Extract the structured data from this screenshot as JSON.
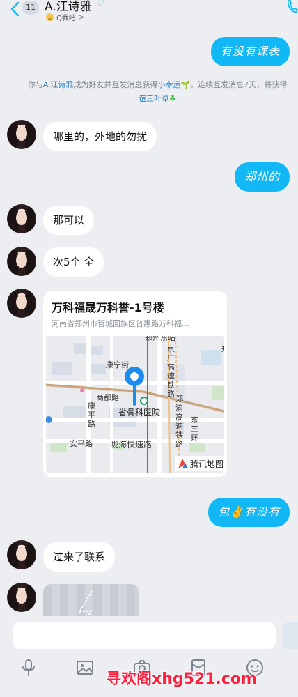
{
  "header": {
    "unread_count": "11",
    "contact_name": "A.江诗雅",
    "contact_name_mark": "♡",
    "qzone_label": "Q我吧",
    "qzone_arrow": ">"
  },
  "messages": [
    {
      "side": "out",
      "text": "有没有课表"
    },
    {
      "side": "system",
      "parts": [
        "你与",
        "A.江诗雅",
        "成为好友并互发消息获得",
        "小幸运",
        "🌱。连续互发消息7天，将获得",
        "谊三叶草",
        "☘"
      ]
    },
    {
      "side": "in",
      "text": "哪里的，外地的勿扰"
    },
    {
      "side": "out",
      "text": "郑州的"
    },
    {
      "side": "in",
      "text": "那可以"
    },
    {
      "side": "in",
      "text": "次5个 全"
    },
    {
      "side": "in",
      "type": "location"
    },
    {
      "side": "out",
      "text": "包✌有没有"
    },
    {
      "side": "in",
      "text": "过来了联系"
    },
    {
      "side": "in",
      "type": "image-loading"
    }
  ],
  "location": {
    "title": "万科福晟万科誉-1号楼",
    "address": "河南省郑州市管城回族区普惠路万科福...",
    "map_labels": {
      "top_road": "郑州东站",
      "kangning": "康宁街",
      "shangdu": "商都路",
      "kangping": [
        "康",
        "平",
        "路"
      ],
      "hospital": "省骨科医院",
      "jinggang": [
        "京",
        "广",
        "高",
        "速",
        "铁",
        "路"
      ],
      "zhengyu": [
        "郑",
        "渝",
        "高",
        "速",
        "铁",
        "路"
      ],
      "dongsan": [
        "东",
        "三",
        "环"
      ],
      "anping": "安平路",
      "longhai": "陇海快速路",
      "provider": "腾讯地图",
      "edge_char": "郑"
    }
  },
  "input": {
    "placeholder": ""
  },
  "toolbar": [
    "microphone-icon",
    "image-icon",
    "camera-icon",
    "red-packet-icon",
    "emoji-icon"
  ],
  "watermark": "寻欢阁xhg521.com",
  "colors": {
    "accent": "#12b7f5",
    "link": "#2f80c3",
    "background": "#eceef2",
    "watermark": "#ff1f3d"
  }
}
